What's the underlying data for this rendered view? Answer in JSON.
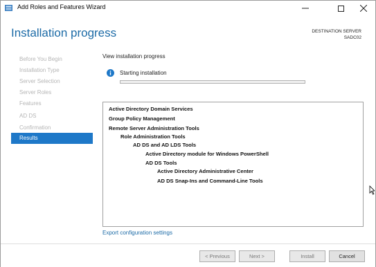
{
  "window": {
    "title": "Add Roles and Features Wizard",
    "controls": {
      "minimize": "—",
      "maximize": "☐",
      "close": "✕"
    }
  },
  "header": {
    "page_title": "Installation progress",
    "destination_label": "DESTINATION SERVER",
    "destination_server": "SADC02"
  },
  "sidebar": {
    "items": [
      {
        "label": "Before You Begin",
        "active": false
      },
      {
        "label": "Installation Type",
        "active": false
      },
      {
        "label": "Server Selection",
        "active": false
      },
      {
        "label": "Server Roles",
        "active": false
      },
      {
        "label": "Features",
        "active": false
      },
      {
        "label": "AD DS",
        "active": false
      },
      {
        "label": "Confirmation",
        "active": false
      },
      {
        "label": "Results",
        "active": true
      }
    ]
  },
  "main": {
    "section_title": "View installation progress",
    "status_icon": "info-icon",
    "status_text": "Starting installation",
    "progress_fraction": 0.0,
    "results": [
      {
        "text": "Active Directory Domain Services",
        "indent": 0
      },
      {
        "text": "Group Policy Management",
        "indent": 0
      },
      {
        "text": "Remote Server Administration Tools",
        "indent": 0
      },
      {
        "text": "Role Administration Tools",
        "indent": 1
      },
      {
        "text": "AD DS and AD LDS Tools",
        "indent": 2
      },
      {
        "text": "Active Directory module for Windows PowerShell",
        "indent": 3
      },
      {
        "text": "AD DS Tools",
        "indent": 3
      },
      {
        "text": "Active Directory Administrative Center",
        "indent": 4
      },
      {
        "text": "AD DS Snap-Ins and Command-Line Tools",
        "indent": 4
      }
    ],
    "export_link": "Export configuration settings"
  },
  "footer": {
    "previous": "< Previous",
    "next": "Next >",
    "install": "Install",
    "cancel": "Cancel"
  },
  "colors": {
    "accent": "#1e78c8",
    "title_blue": "#1b6aa6",
    "progress_green": "#06b025"
  }
}
